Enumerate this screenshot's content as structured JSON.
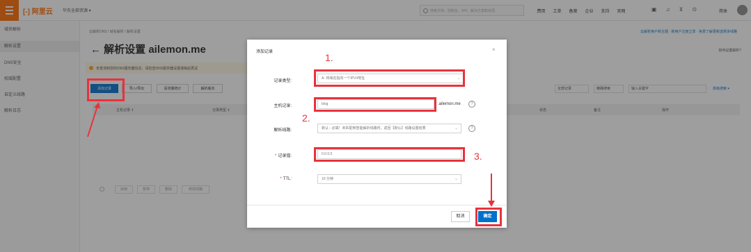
{
  "topbar": {
    "logo": "[-] 阿里云",
    "workbench": "华东全部资源 ▾",
    "search_placeholder": "搜索文档、控制台、API、解决方案和资源",
    "nav": [
      "费用",
      "工单",
      "备案",
      "企业",
      "支持",
      "官网"
    ],
    "icons": [
      "terminal-icon",
      "bell-icon",
      "cart-icon",
      "help-icon"
    ],
    "lang": "简体"
  },
  "sidebar": {
    "items": [
      "域名解析",
      "解析设置",
      "DNS安全",
      "权威配置",
      "自定义线路",
      "解析日志"
    ],
    "active_index": 1
  },
  "main": {
    "breadcrumb": "云解析DNS / 域名解析 / 解析设置",
    "top_link": "云解析用户新主题 · 新用户注册立享 · 免费了解更新选择多线路",
    "title": "← 解析设置 ailemon.me",
    "help": "如何设置解析?",
    "notice": "未查询到您的DNS服务器信息，请检查DNS服务器设置或稍后再试",
    "toolbar": {
      "add": "添加记录",
      "import": "导入/导出",
      "request_stats": "请求量统计",
      "version": "解析版本"
    },
    "filters": {
      "all_records": "全部记录",
      "exact": "精确搜索",
      "keyword_placeholder": "输入关键字",
      "advanced": "高级搜索 ▾"
    },
    "table_headers": [
      "主机记录 ⇕",
      "记录类型 ⇕",
      "状态",
      "备注",
      "操作"
    ],
    "batch": [
      "启用",
      "暂停",
      "删除",
      "修改线路"
    ]
  },
  "dialog": {
    "title": "添加记录",
    "close": "×",
    "fields": {
      "type_label": "记录类型:",
      "type_value": "A- 将域名指向一个IPV4地址",
      "host_label": "主机记录:",
      "host_value": "blog",
      "host_suffix": ".ailemon.me",
      "line_label": "解析线路:",
      "line_value": "默认 - 必填！未匹配到智能解析线路时，返回【默认】线路设置结果",
      "value_label": "记录值:",
      "value_value": "0.0.0.0",
      "ttl_label": "TTL:",
      "ttl_value": "10 分钟"
    },
    "cancel": "取消",
    "ok": "确定"
  },
  "annotations": {
    "step1": "1.",
    "step2": "2.",
    "step3": "3.",
    "color": "#e8323c"
  },
  "colors": {
    "brand": "#ff6a00",
    "primary": "#0070cc"
  }
}
